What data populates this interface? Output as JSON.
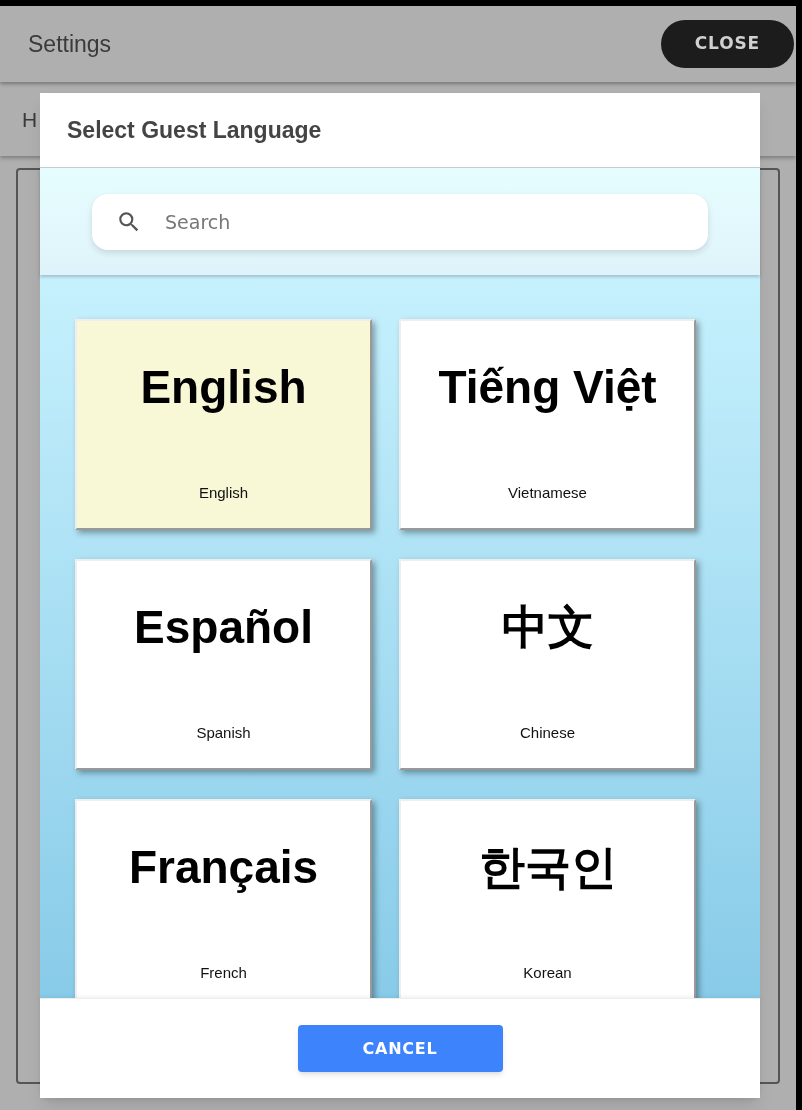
{
  "page": {
    "title": "Settings",
    "close_button": "CLOSE",
    "section_title": "H"
  },
  "dialog": {
    "title": "Select Guest Language",
    "search": {
      "placeholder": "Search"
    },
    "languages": [
      {
        "native": "English",
        "name": "English",
        "selected": true
      },
      {
        "native": "Tiếng Việt",
        "name": "Vietnamese",
        "selected": false
      },
      {
        "native": "Español",
        "name": "Spanish",
        "selected": false
      },
      {
        "native": "中文",
        "name": "Chinese",
        "selected": false
      },
      {
        "native": "Français",
        "name": "French",
        "selected": false
      },
      {
        "native": "한국인",
        "name": "Korean",
        "selected": false
      }
    ],
    "cancel_button": "CANCEL"
  }
}
